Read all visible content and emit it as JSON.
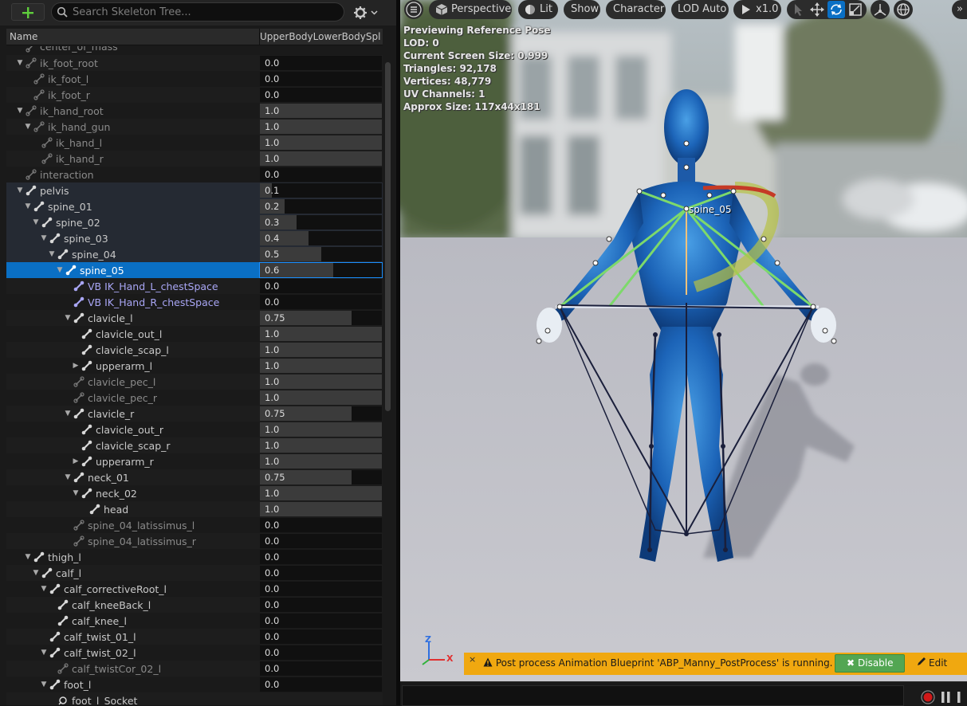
{
  "skeleton_tree": {
    "add_button": "+",
    "search_placeholder": "Search Skeleton Tree...",
    "settings_icon": "gear-icon",
    "columns": {
      "name": "Name",
      "value": "UpperBodyLowerBodySpli"
    },
    "rows": [
      {
        "name": "center_of_mass",
        "value": "",
        "level": 1,
        "toggle": "none",
        "faded": true,
        "partial": true
      },
      {
        "name": "ik_foot_root",
        "value": "0.0",
        "fill": 0,
        "level": 1,
        "toggle": "open",
        "faded": true
      },
      {
        "name": "ik_foot_l",
        "value": "0.0",
        "fill": 0,
        "level": 2,
        "toggle": "none",
        "faded": true
      },
      {
        "name": "ik_foot_r",
        "value": "0.0",
        "fill": 0,
        "level": 2,
        "toggle": "none",
        "faded": true
      },
      {
        "name": "ik_hand_root",
        "value": "1.0",
        "fill": 1,
        "level": 1,
        "toggle": "open",
        "faded": true
      },
      {
        "name": "ik_hand_gun",
        "value": "1.0",
        "fill": 1,
        "level": 2,
        "toggle": "open",
        "faded": true
      },
      {
        "name": "ik_hand_l",
        "value": "1.0",
        "fill": 1,
        "level": 3,
        "toggle": "none",
        "faded": true
      },
      {
        "name": "ik_hand_r",
        "value": "1.0",
        "fill": 1,
        "level": 3,
        "toggle": "none",
        "faded": true
      },
      {
        "name": "interaction",
        "value": "0.0",
        "fill": 0,
        "level": 1,
        "toggle": "none",
        "faded": true
      },
      {
        "name": "pelvis",
        "value": "0.1",
        "fill": 0.1,
        "level": 1,
        "toggle": "open",
        "shade": true
      },
      {
        "name": "spine_01",
        "value": "0.2",
        "fill": 0.2,
        "level": 2,
        "toggle": "open",
        "shade": true
      },
      {
        "name": "spine_02",
        "value": "0.3",
        "fill": 0.3,
        "level": 3,
        "toggle": "open",
        "shade": true
      },
      {
        "name": "spine_03",
        "value": "0.4",
        "fill": 0.4,
        "level": 4,
        "toggle": "open",
        "shade": true
      },
      {
        "name": "spine_04",
        "value": "0.5",
        "fill": 0.5,
        "level": 5,
        "toggle": "open",
        "shade": true
      },
      {
        "name": "spine_05",
        "value": "0.6",
        "fill": 0.6,
        "level": 6,
        "toggle": "open",
        "selected": true
      },
      {
        "name": "VB IK_Hand_L_chestSpace",
        "value": "0.0",
        "fill": 0,
        "level": 7,
        "toggle": "none",
        "vb": true
      },
      {
        "name": "VB IK_Hand_R_chestSpace",
        "value": "0.0",
        "fill": 0,
        "level": 7,
        "toggle": "none",
        "vb": true
      },
      {
        "name": "clavicle_l",
        "value": "0.75",
        "fill": 0.75,
        "level": 7,
        "toggle": "open"
      },
      {
        "name": "clavicle_out_l",
        "value": "1.0",
        "fill": 1,
        "level": 8,
        "toggle": "none"
      },
      {
        "name": "clavicle_scap_l",
        "value": "1.0",
        "fill": 1,
        "level": 8,
        "toggle": "none"
      },
      {
        "name": "upperarm_l",
        "value": "1.0",
        "fill": 1,
        "level": 8,
        "toggle": "closed"
      },
      {
        "name": "clavicle_pec_l",
        "value": "1.0",
        "fill": 1,
        "level": 7,
        "toggle": "none",
        "faded": true
      },
      {
        "name": "clavicle_pec_r",
        "value": "1.0",
        "fill": 1,
        "level": 7,
        "toggle": "none",
        "faded": true
      },
      {
        "name": "clavicle_r",
        "value": "0.75",
        "fill": 0.75,
        "level": 7,
        "toggle": "open"
      },
      {
        "name": "clavicle_out_r",
        "value": "1.0",
        "fill": 1,
        "level": 8,
        "toggle": "none"
      },
      {
        "name": "clavicle_scap_r",
        "value": "1.0",
        "fill": 1,
        "level": 8,
        "toggle": "none"
      },
      {
        "name": "upperarm_r",
        "value": "1.0",
        "fill": 1,
        "level": 8,
        "toggle": "closed"
      },
      {
        "name": "neck_01",
        "value": "0.75",
        "fill": 0.75,
        "level": 7,
        "toggle": "open"
      },
      {
        "name": "neck_02",
        "value": "1.0",
        "fill": 1,
        "level": 8,
        "toggle": "open"
      },
      {
        "name": "head",
        "value": "1.0",
        "fill": 1,
        "level": 9,
        "toggle": "none"
      },
      {
        "name": "spine_04_latissimus_l",
        "value": "0.0",
        "fill": 0,
        "level": 7,
        "toggle": "none",
        "faded": true
      },
      {
        "name": "spine_04_latissimus_r",
        "value": "0.0",
        "fill": 0,
        "level": 7,
        "toggle": "none",
        "faded": true
      },
      {
        "name": "thigh_l",
        "value": "0.0",
        "fill": 0,
        "level": 2,
        "toggle": "open"
      },
      {
        "name": "calf_l",
        "value": "0.0",
        "fill": 0,
        "level": 3,
        "toggle": "open"
      },
      {
        "name": "calf_correctiveRoot_l",
        "value": "0.0",
        "fill": 0,
        "level": 4,
        "toggle": "open"
      },
      {
        "name": "calf_kneeBack_l",
        "value": "0.0",
        "fill": 0,
        "level": 5,
        "toggle": "none"
      },
      {
        "name": "calf_knee_l",
        "value": "0.0",
        "fill": 0,
        "level": 5,
        "toggle": "none"
      },
      {
        "name": "calf_twist_01_l",
        "value": "0.0",
        "fill": 0,
        "level": 4,
        "toggle": "none"
      },
      {
        "name": "calf_twist_02_l",
        "value": "0.0",
        "fill": 0,
        "level": 4,
        "toggle": "open"
      },
      {
        "name": "calf_twistCor_02_l",
        "value": "0.0",
        "fill": 0,
        "level": 5,
        "toggle": "none",
        "faded": true
      },
      {
        "name": "foot_l",
        "value": "0.0",
        "fill": 0,
        "level": 4,
        "toggle": "open"
      },
      {
        "name": "foot_l_Socket",
        "value": "",
        "level": 5,
        "toggle": "none",
        "socket": true
      }
    ]
  },
  "viewport": {
    "toolbar": {
      "menu_icon": "hamburger-icon",
      "perspective": "Perspective",
      "lit": "Lit",
      "show": "Show",
      "character": "Character",
      "lod": "LOD Auto",
      "speed": "x1.0"
    },
    "stats": [
      "Previewing Reference Pose",
      "LOD: 0",
      "Current Screen Size: 0.999",
      "Triangles: 92,178",
      "Vertices: 48,779",
      "UV Channels: 1",
      "Approx Size: 117x44x181"
    ],
    "selected_bone_label": "spine_05",
    "axis": {
      "z": "Z",
      "x": "X"
    },
    "notification": {
      "message": "Post process Animation Blueprint 'ABP_Manny_PostProcess' is running.",
      "disable_label": "Disable",
      "edit_label": "Edit",
      "close": "×"
    }
  },
  "colors": {
    "selection": "#0a6fc4",
    "vb_text": "#a9a6f5",
    "warning": "#f0a810",
    "disable_green": "#53a653"
  }
}
